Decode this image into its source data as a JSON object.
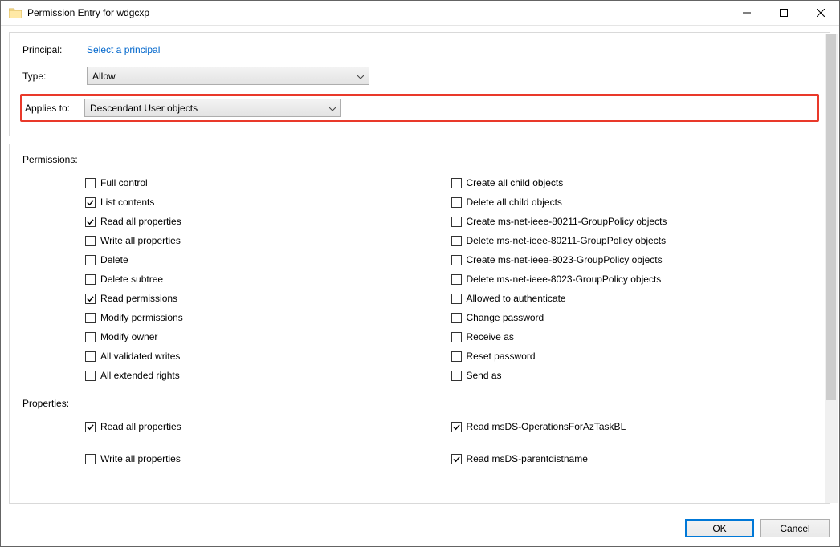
{
  "window": {
    "title": "Permission Entry for wdgcxp"
  },
  "top": {
    "principal_label": "Principal:",
    "principal_link": "Select a principal",
    "type_label": "Type:",
    "type_value": "Allow",
    "applies_label": "Applies to:",
    "applies_value": "Descendant User objects"
  },
  "sections": {
    "permissions_label": "Permissions:",
    "properties_label": "Properties:"
  },
  "permissions_left": [
    {
      "label": "Full control",
      "checked": false
    },
    {
      "label": "List contents",
      "checked": true
    },
    {
      "label": "Read all properties",
      "checked": true
    },
    {
      "label": "Write all properties",
      "checked": false
    },
    {
      "label": "Delete",
      "checked": false
    },
    {
      "label": "Delete subtree",
      "checked": false
    },
    {
      "label": "Read permissions",
      "checked": true
    },
    {
      "label": "Modify permissions",
      "checked": false
    },
    {
      "label": "Modify owner",
      "checked": false
    },
    {
      "label": "All validated writes",
      "checked": false
    },
    {
      "label": "All extended rights",
      "checked": false
    }
  ],
  "permissions_right": [
    {
      "label": "Create all child objects",
      "checked": false
    },
    {
      "label": "Delete all child objects",
      "checked": false
    },
    {
      "label": "Create ms-net-ieee-80211-GroupPolicy objects",
      "checked": false
    },
    {
      "label": "Delete ms-net-ieee-80211-GroupPolicy objects",
      "checked": false
    },
    {
      "label": "Create ms-net-ieee-8023-GroupPolicy objects",
      "checked": false
    },
    {
      "label": "Delete ms-net-ieee-8023-GroupPolicy objects",
      "checked": false
    },
    {
      "label": "Allowed to authenticate",
      "checked": false
    },
    {
      "label": "Change password",
      "checked": false
    },
    {
      "label": "Receive as",
      "checked": false
    },
    {
      "label": "Reset password",
      "checked": false
    },
    {
      "label": "Send as",
      "checked": false
    }
  ],
  "properties_left": [
    {
      "label": "Read all properties",
      "checked": true
    },
    {
      "label": "Write all properties",
      "checked": false
    }
  ],
  "properties_right": [
    {
      "label": "Read msDS-OperationsForAzTaskBL",
      "checked": true
    },
    {
      "label": "Read msDS-parentdistname",
      "checked": true
    }
  ],
  "footer": {
    "ok": "OK",
    "cancel": "Cancel"
  }
}
